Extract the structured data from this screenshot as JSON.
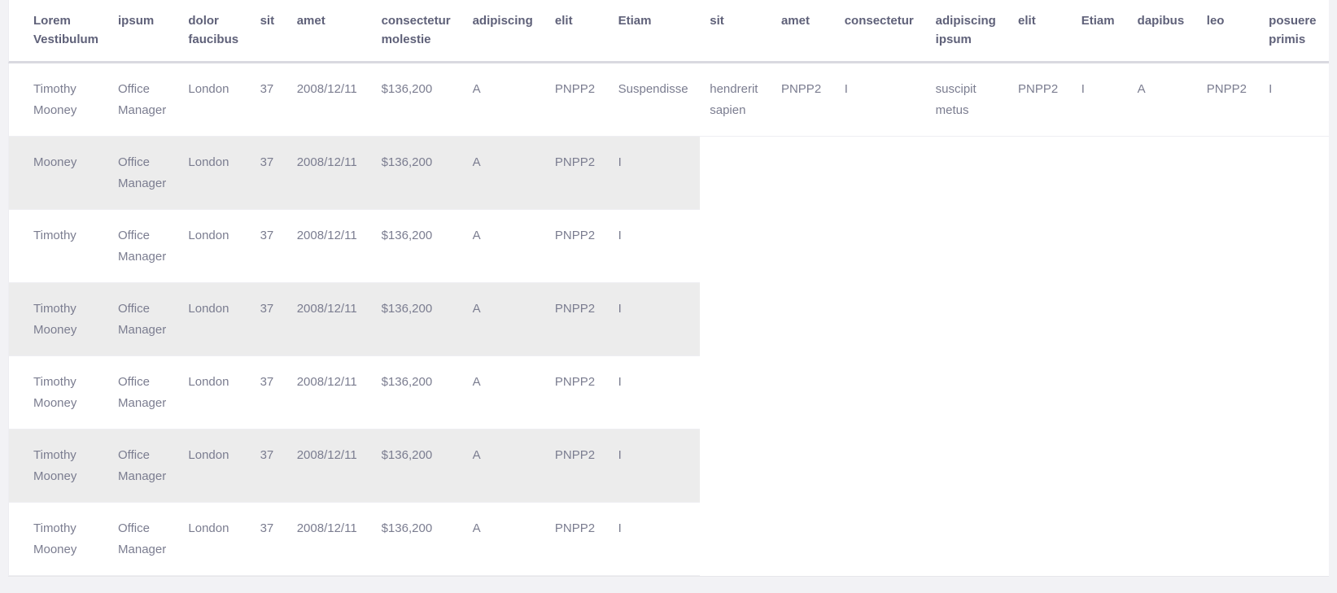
{
  "table": {
    "columns": [
      "Lorem Vestibulum",
      "ipsum",
      "dolor faucibus",
      "sit",
      "amet",
      "consectetur molestie",
      "adipiscing",
      "elit",
      "Etiam",
      "sit",
      "amet",
      "consectetur",
      "adipiscing ipsum",
      "elit",
      "Etiam",
      "dapibus",
      "leo",
      "posuere primis"
    ],
    "narrow_col_count": 9,
    "rows": [
      [
        "Timothy Mooney",
        "Office Manager",
        "London",
        "37",
        "2008/12/11",
        "$136,200",
        "A",
        "PNPP2",
        "Suspendisse",
        "hendrerit sapien",
        "PNPP2",
        "I",
        "suscipit metus",
        "PNPP2",
        "I",
        "A",
        "PNPP2",
        "I"
      ],
      [
        "Mooney",
        "Office Manager",
        "London",
        "37",
        "2008/12/11",
        "$136,200",
        "A",
        "PNPP2",
        "I"
      ],
      [
        "Timothy",
        "Office Manager",
        "London",
        "37",
        "2008/12/11",
        "$136,200",
        "A",
        "PNPP2",
        "I"
      ],
      [
        "Timothy Mooney",
        "Office Manager",
        "London",
        "37",
        "2008/12/11",
        "$136,200",
        "A",
        "PNPP2",
        "I"
      ],
      [
        "Timothy Mooney",
        "Office Manager",
        "London",
        "37",
        "2008/12/11",
        "$136,200",
        "A",
        "PNPP2",
        "I"
      ],
      [
        "Timothy Mooney",
        "Office Manager",
        "London",
        "37",
        "2008/12/11",
        "$136,200",
        "A",
        "PNPP2",
        "I"
      ],
      [
        "Timothy Mooney",
        "Office Manager",
        "London",
        "37",
        "2008/12/11",
        "$136,200",
        "A",
        "PNPP2",
        "I"
      ]
    ]
  }
}
